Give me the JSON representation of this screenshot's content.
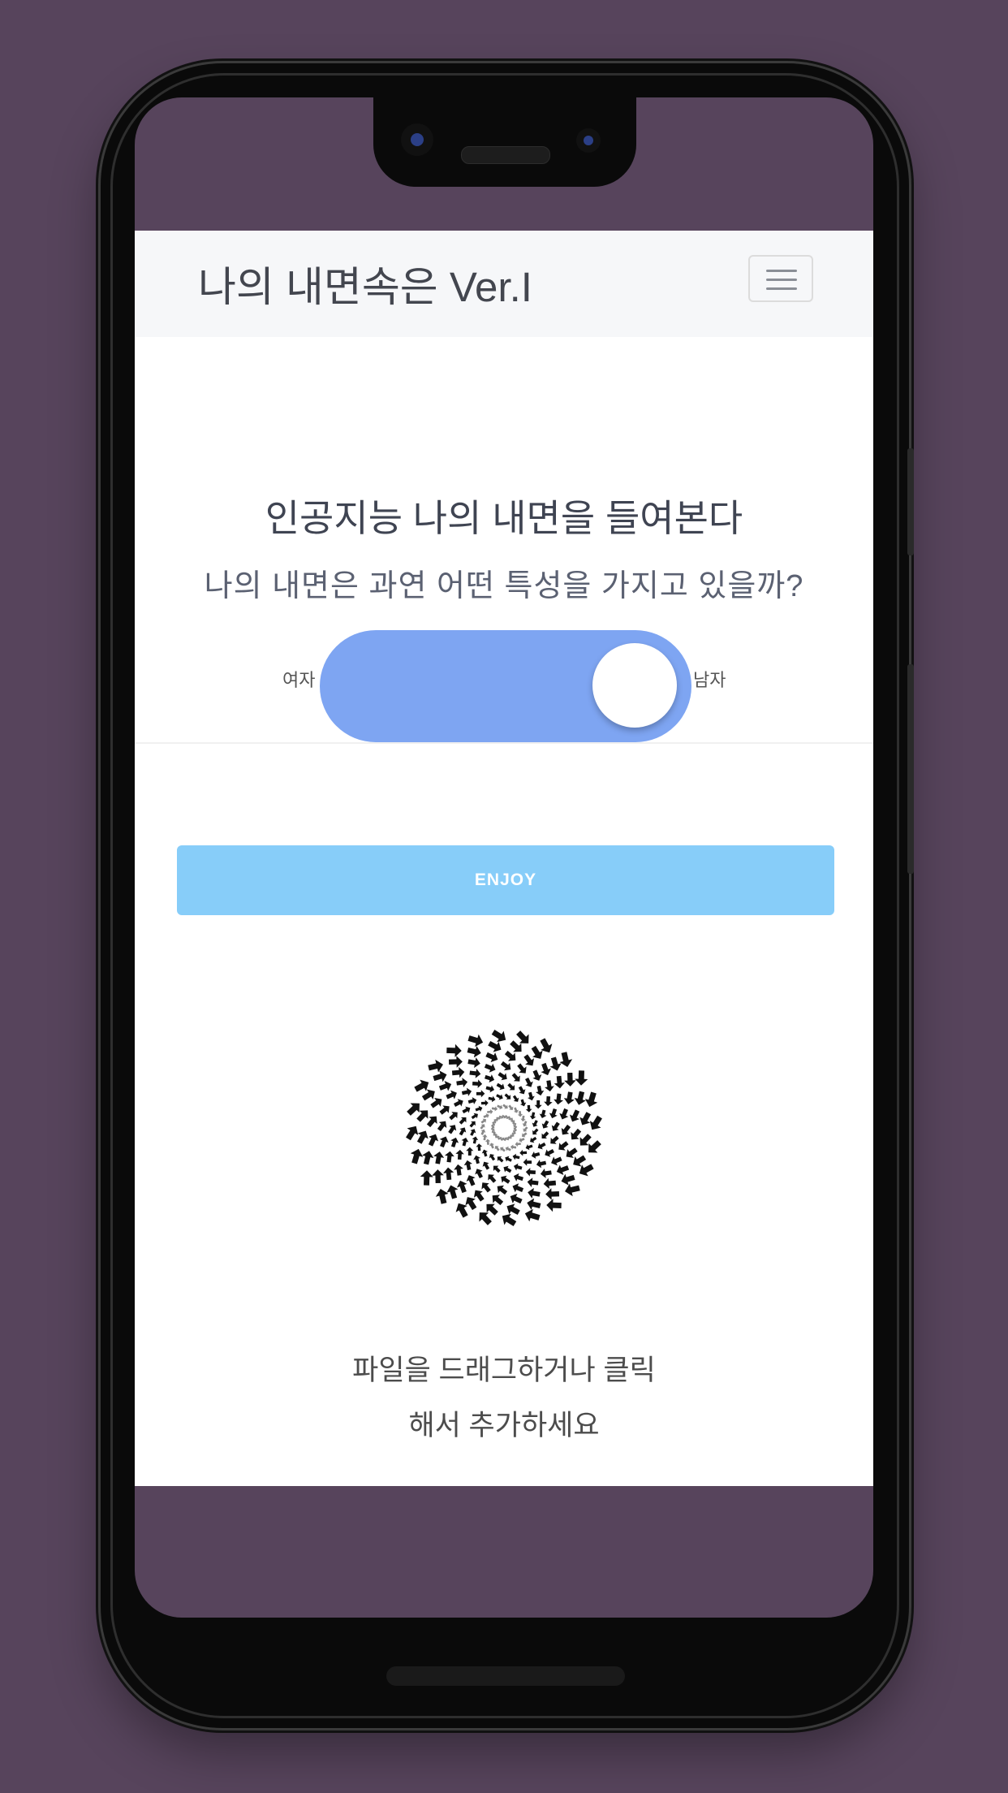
{
  "navbar": {
    "brand": "나의 내면속은 Ver.I",
    "menu_icon": "hamburger-menu-icon"
  },
  "hero": {
    "headline": "인공지능 나의 내면을 들여본다",
    "subline": "나의 내면은 과연 어떤 특성을 가지고 있을까?"
  },
  "gender_toggle": {
    "left_label": "여자",
    "right_label": "남자",
    "selected": "남자",
    "on_color": "#7ea5f2"
  },
  "enjoy_button": {
    "label": "ENJOY",
    "color": "#87cdf9"
  },
  "upload": {
    "icon": "spiral-arrows-icon",
    "line1": "파일을 드래그하거나 클릭",
    "line2": "해서 추가하세요"
  },
  "colors": {
    "background": "#57445c",
    "navbar": "#f6f7f9"
  }
}
